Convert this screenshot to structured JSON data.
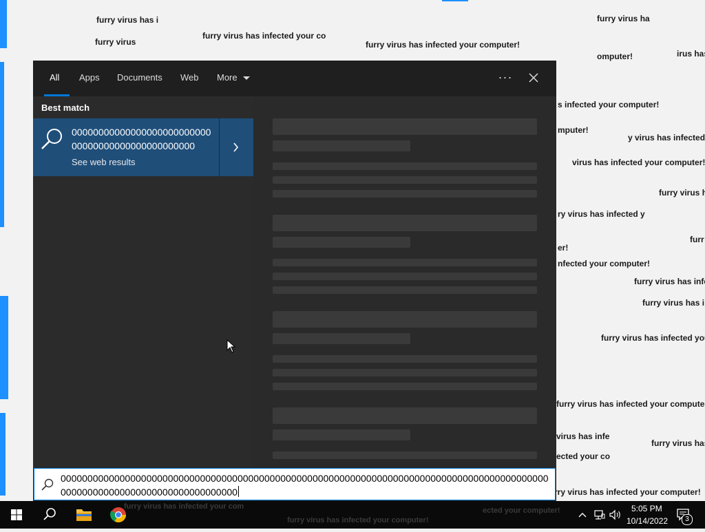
{
  "desktop": {
    "spam_text": "furry virus has infected your computer!",
    "fragments": [
      "furry virus has i",
      "furry virus has infected your co",
      "furry virus has infected your computer!",
      "furry virus ha",
      "furry virus",
      "omputer!",
      "irus has",
      "s infected your computer!",
      "mputer!",
      "y virus has infected",
      "virus has infected your computer!",
      "furry virus h",
      "ry virus has infected y",
      "furr",
      "er!",
      "nfected your computer!",
      "furry virus has infe",
      "furry virus has i",
      "furry virus has infected you",
      "furry virus has infected your computer",
      "virus has infe",
      "furry virus has",
      "ected your co",
      "rry virus has infected your computer!"
    ]
  },
  "search": {
    "tabs": [
      "All",
      "Apps",
      "Documents",
      "Web",
      "More"
    ],
    "active_tab": "All",
    "more_options_label": "···",
    "best_match_label": "Best match",
    "result_title": "0000000000000000000000000000000000000000000000000",
    "result_subtitle": "See web results",
    "query": "0000000000000000000000000000000000000000000000000000000000000000000000000000000000000000000000000000000000000000000000000000"
  },
  "taskbar": {
    "time": "5:05 PM",
    "date": "10/14/2022",
    "notification_count": "3",
    "ghost_text": [
      "furry virus has infected your com",
      "furry virus has infected your computer!",
      "ected your computer!"
    ]
  },
  "colors": {
    "accent": "#0078d7",
    "selection": "#1f4e79",
    "taskbar": "#0a0a0a"
  }
}
